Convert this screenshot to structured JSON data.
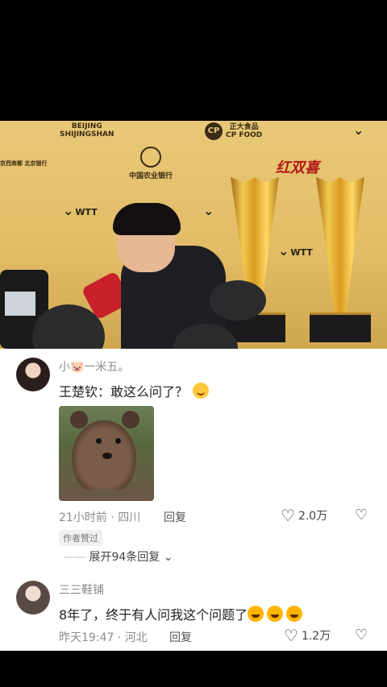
{
  "video": {
    "sponsor_beijing": "BEIJING",
    "sponsor_shougang": "SHIJINGSHAN",
    "sponsor_cp": "正大食品",
    "sponsor_cp_sub": "CP FOOD",
    "sponsor_bank": "中国农业银行",
    "sponsor_hsb": "红双喜",
    "wtt_text": "WTT",
    "left_sponsor": "京西商都 北京银行"
  },
  "comments": [
    {
      "username": "小🐷一米五。",
      "text": "王楚钦：敢这么问了？",
      "time": "21小时前",
      "location": "四川",
      "reply_label": "回复",
      "likes": "2.0万",
      "badge": "作者赞过",
      "expand_label": "展开94条回复",
      "has_image": true
    },
    {
      "username": "三三鞋铺",
      "text": "8年了，终于有人问我这个问题了",
      "time": "昨天19:47",
      "location": "河北",
      "reply_label": "回复",
      "likes": "1.2万"
    }
  ]
}
